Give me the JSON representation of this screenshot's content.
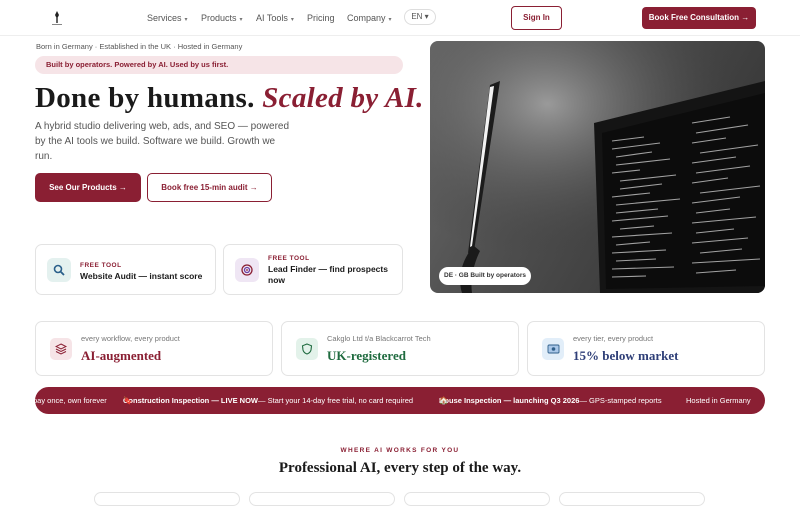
{
  "nav": {
    "links": [
      {
        "label": "Services",
        "caret": "▾"
      },
      {
        "label": "Products",
        "caret": "▾"
      },
      {
        "label": "AI Tools",
        "caret": "▾"
      },
      {
        "label": "Pricing",
        "caret": ""
      },
      {
        "label": "Company",
        "caret": "▾"
      }
    ],
    "lang": "EN ▾",
    "signin": "Sign In",
    "cta": "Book Free Consultation →"
  },
  "hero": {
    "meta": "Born in Germany · Established in the UK · Hosted in Germany",
    "pill": "Built by operators. Powered by AI. Used by us first.",
    "headline_plain": "Done by humans.",
    "headline_accent": "Scaled by AI.",
    "subtitle": "A hybrid studio delivering web, ads, and SEO — powered by the AI tools we build. Software we build. Growth we run.",
    "primary_button": "See Our Products →",
    "secondary_button": "Book free 15-min audit →",
    "image_badge": "DE · GB Built by operators"
  },
  "tools": [
    {
      "kicker": "FREE TOOL",
      "title": "Website Audit — instant score",
      "icon": "magnifier-icon"
    },
    {
      "kicker": "FREE TOOL",
      "title": "Lead Finder — find prospects now",
      "icon": "target-icon"
    }
  ],
  "stats": [
    {
      "label": "every workflow, every product",
      "value": "AI-augmented",
      "color": "#8a1f33",
      "icon": "layers-icon"
    },
    {
      "label": "Cakglo Ltd t/a Blackcarrot Tech",
      "value": "UK-registered",
      "color": "#1f6b3f",
      "icon": "shield-icon"
    },
    {
      "label": "every tier, every product",
      "value": "15% below market",
      "color": "#2f3f78",
      "icon": "money-icon"
    }
  ],
  "ticker": {
    "item0": "pay once, own forever",
    "item1_bold": "Construction Inspection — LIVE NOW",
    "item1_rest": " — Start your 14-day free trial, no card required",
    "item2_bold": "House Inspection — launching Q3 2026",
    "item2_rest": " — GPS-stamped reports",
    "item3": "Hosted in Germany"
  },
  "section": {
    "kicker": "WHERE AI WORKS FOR YOU",
    "title": "Professional AI, every step of the way."
  },
  "colors": {
    "brand": "#8a1f33"
  }
}
